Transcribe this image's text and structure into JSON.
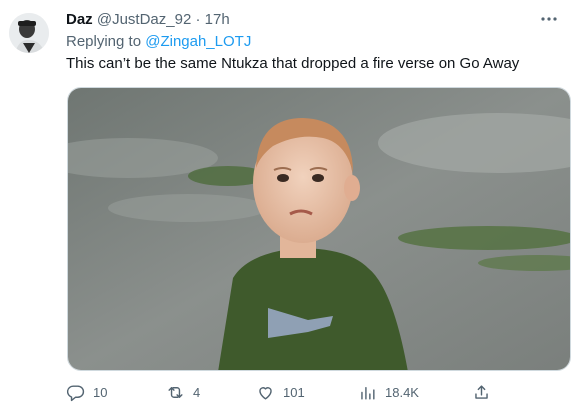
{
  "tweet": {
    "display_name": "Daz",
    "handle": "@JustDaz_92",
    "separator": "·",
    "time": "17h",
    "reply_prefix": "Replying to",
    "reply_mention": "@Zingah_LOTJ",
    "text": "This can’t be the same Ntukza that dropped a fire verse on Go Away",
    "media_icon": "photo-of-toddler"
  },
  "actions": {
    "replies": "10",
    "retweets": "4",
    "likes": "101",
    "views": "18.4K"
  },
  "colors": {
    "accent": "#1d9bf0",
    "muted": "#536471",
    "text": "#0f1419"
  }
}
